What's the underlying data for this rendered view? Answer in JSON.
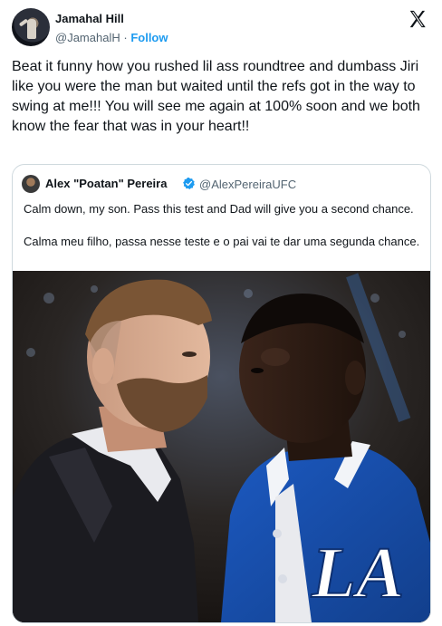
{
  "author": {
    "name": "Jamahal Hill",
    "handle": "@JamahalH",
    "separator": "·",
    "follow_label": "Follow",
    "avatar_icon": "profile-photo"
  },
  "platform_icon": "x-logo-icon",
  "tweet": {
    "text": "Beat it funny how you rushed lil ass roundtree and dumbass Jiri like you were the man but waited until the refs got in the way to swing at me!!! You will see me again at 100% soon and we both know the fear that was in your heart!!"
  },
  "quoted": {
    "name": "Alex \"Poatan\" Pereira",
    "handle": "@AlexPereiraUFC",
    "verified_icon": "verified-badge-icon",
    "text_en": "Calm down, my son. Pass this test and Dad will give you a second chance.",
    "text_pt": "Calma meu filho, passa nesse teste e o pai vai te dar uma segunda chance."
  },
  "colors": {
    "link": "#1d9bf0",
    "text": "#0f1419",
    "secondary": "#536471",
    "border": "#cfd9de",
    "dodgers_blue": "#1b55b8"
  }
}
